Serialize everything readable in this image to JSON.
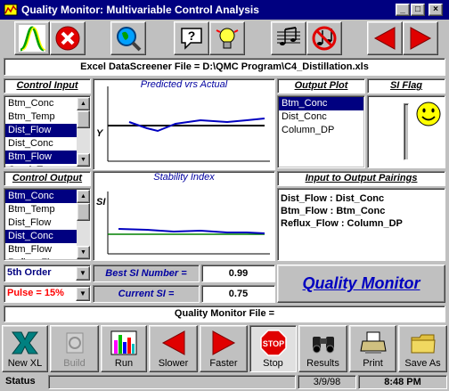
{
  "window": {
    "title": "Quality Monitor: Multivariable Control Analysis",
    "controls": [
      "_",
      "□",
      "×"
    ]
  },
  "toolbar": {
    "buttons": [
      "bell-curve",
      "stop-x",
      "magnifier-globe",
      "help",
      "idea",
      "music",
      "no-music",
      "back",
      "forward"
    ]
  },
  "file_bar": {
    "text": "Excel DataScreener File = D:\\QMC Program\\C4_Distillation.xls"
  },
  "control_input": {
    "label": "Control Input",
    "items": [
      {
        "text": "Btm_Conc",
        "selected": false
      },
      {
        "text": "Btm_Temp",
        "selected": false
      },
      {
        "text": "Dist_Flow",
        "selected": true
      },
      {
        "text": "Dist_Conc",
        "selected": false
      },
      {
        "text": "Btm_Flow",
        "selected": true
      },
      {
        "text": "Cond_Temp",
        "selected": false
      }
    ]
  },
  "control_output": {
    "label": "Control Output",
    "items": [
      {
        "text": "Btm_Conc",
        "selected": true
      },
      {
        "text": "Btm_Temp",
        "selected": false
      },
      {
        "text": "Dist_Flow",
        "selected": false
      },
      {
        "text": "Dist_Conc",
        "selected": true
      },
      {
        "text": "Btm_Flow",
        "selected": false
      },
      {
        "text": "Reflux_Flow",
        "selected": false
      }
    ]
  },
  "predicted_chart": {
    "title_a": "Predicted vrs ",
    "title_b": "Actual",
    "ylabel": "Y"
  },
  "stability_chart": {
    "title": "Stability Index",
    "ylabel": "SI"
  },
  "output_plot": {
    "label": "Output Plot",
    "items": [
      {
        "text": "Btm_Conc",
        "selected": true
      },
      {
        "text": "Dist_Conc",
        "selected": false
      },
      {
        "text": "Column_DP",
        "selected": false
      }
    ]
  },
  "si_flag": {
    "label": "SI Flag",
    "icon": "smiley-face",
    "color": "#ffff00"
  },
  "pairings": {
    "label": "Input to Output Pairings",
    "items": [
      "Dist_Flow : Dist_Conc",
      "Btm_Flow : Btm_Conc",
      "Reflux_Flow : Column_DP"
    ]
  },
  "order_select": {
    "value": "5th Order"
  },
  "pulse_select": {
    "value": "Pulse = 15%",
    "color": "#ff0000"
  },
  "best_si": {
    "label": "Best SI Number =",
    "value": "0.99"
  },
  "current_si": {
    "label": "Current SI =",
    "value": "0.75"
  },
  "brand": {
    "text": "Quality Monitor",
    "color": "#0000c0"
  },
  "qm_file_bar": {
    "text": "Quality Monitor File ="
  },
  "bottom_buttons": [
    "New XL",
    "Build",
    "Run",
    "Slower",
    "Faster",
    "Stop",
    "Results",
    "Print",
    "Save As"
  ],
  "status_bar": {
    "label": "Status",
    "date": "3/9/98",
    "time": "8:48 PM"
  }
}
